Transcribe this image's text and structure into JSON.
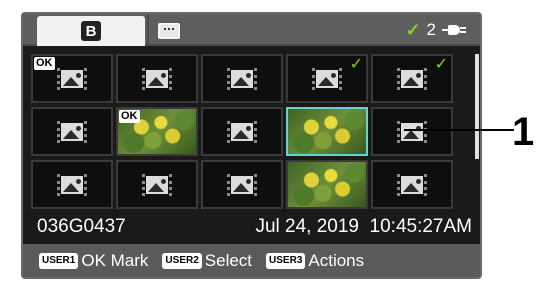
{
  "topbar": {
    "tab_b_label": "B",
    "tab_meta_icon": "metadata-icon",
    "checked_count": "2",
    "check_mark": "✓",
    "power_icon": "ac-power-icon"
  },
  "grid": {
    "rows": [
      [
        {
          "type": "placeholder",
          "ok": true,
          "check": false
        },
        {
          "type": "placeholder",
          "ok": false,
          "check": false
        },
        {
          "type": "placeholder",
          "ok": false,
          "check": false
        },
        {
          "type": "placeholder",
          "ok": false,
          "check": true
        },
        {
          "type": "placeholder",
          "ok": false,
          "check": true
        }
      ],
      [
        {
          "type": "placeholder",
          "ok": false,
          "check": false
        },
        {
          "type": "photo",
          "ok": true,
          "check": false
        },
        {
          "type": "placeholder",
          "ok": false,
          "check": false
        },
        {
          "type": "photo",
          "ok": false,
          "check": false,
          "selected": true
        },
        {
          "type": "placeholder",
          "ok": false,
          "check": false
        }
      ],
      [
        {
          "type": "placeholder",
          "ok": false,
          "check": false
        },
        {
          "type": "placeholder",
          "ok": false,
          "check": false
        },
        {
          "type": "placeholder",
          "ok": false,
          "check": false
        },
        {
          "type": "photo",
          "ok": false,
          "check": false
        },
        {
          "type": "placeholder",
          "ok": false,
          "check": false
        }
      ]
    ],
    "ok_label": "OK",
    "check_mark": "✓"
  },
  "info": {
    "clip_name": "036G0437",
    "datetime": "Jul 24, 2019  10:45:27AM"
  },
  "bottombar": {
    "user1_key": "USER1",
    "user1_label": "OK Mark",
    "user2_key": "USER2",
    "user2_label": "Select",
    "user3_key": "USER3",
    "user3_label": "Actions"
  },
  "callout": {
    "number": "1"
  },
  "colors": {
    "check": "#7ed321",
    "selection": "#6ad0d8"
  }
}
